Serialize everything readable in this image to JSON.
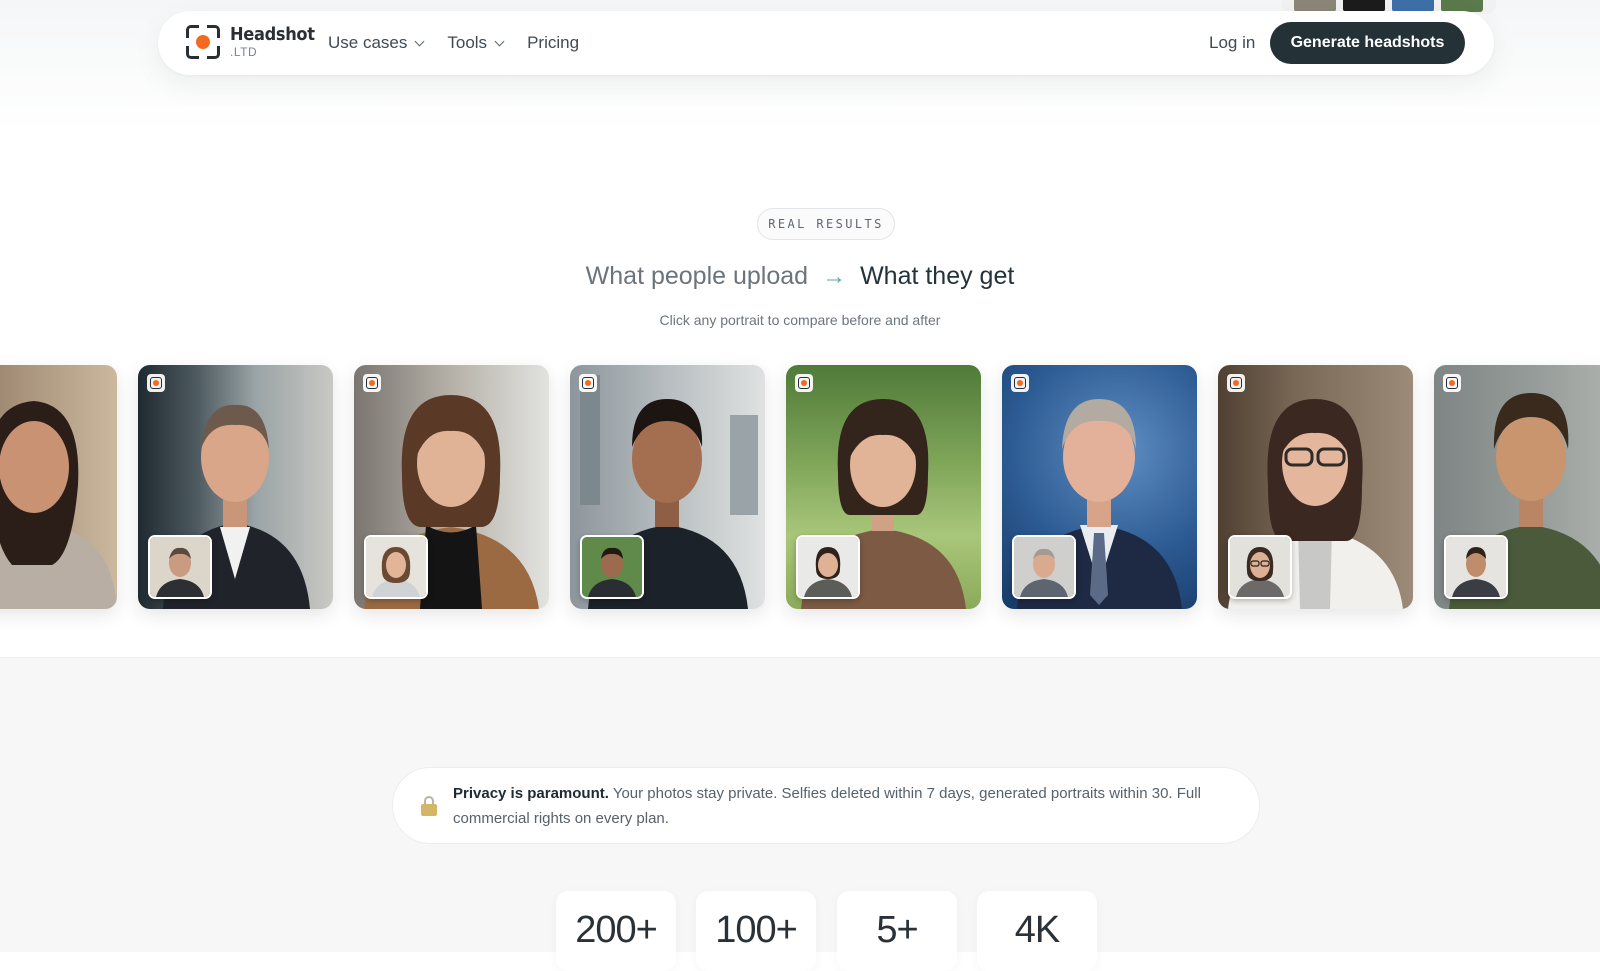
{
  "brand": {
    "name": "Headshot",
    "suffix": ".LTD",
    "accent_color": "#f26a21",
    "dark_color": "#243238"
  },
  "nav": {
    "items": [
      {
        "label": "Use cases",
        "has_dropdown": true
      },
      {
        "label": "Tools",
        "has_dropdown": true
      },
      {
        "label": "Pricing",
        "has_dropdown": false
      }
    ],
    "login_label": "Log in",
    "cta_label": "Generate headshots"
  },
  "results": {
    "badge": "REAL RESULTS",
    "headline_left": "What people upload",
    "headline_arrow": "→",
    "headline_right": "What they get",
    "subtitle": "Click any portrait to compare before and after"
  },
  "privacy": {
    "icon": "lock-icon",
    "bold": "Privacy is paramount.",
    "text": "Your photos stay private. Selfies deleted within 7 days, generated portraits within 30. Full commercial rights on every plan."
  },
  "stats": [
    {
      "value": "200+"
    },
    {
      "value": "100+"
    },
    {
      "value": "5+"
    },
    {
      "value": "4K"
    }
  ]
}
